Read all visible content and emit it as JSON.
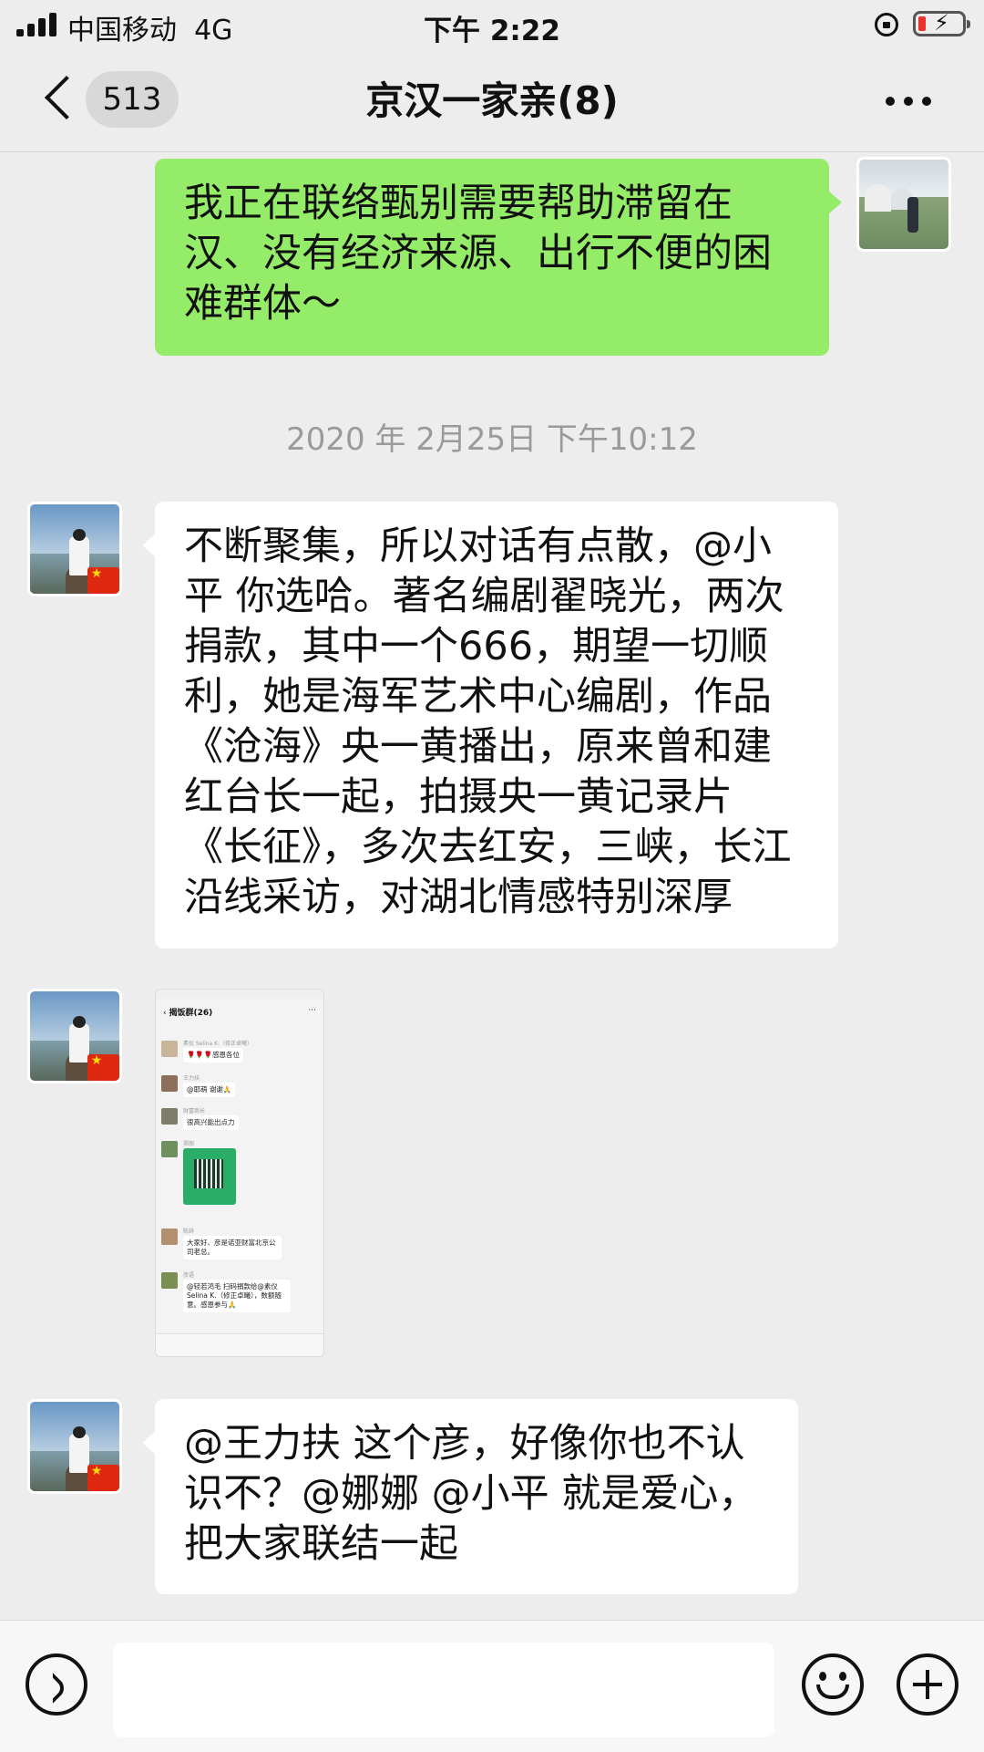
{
  "status_bar": {
    "carrier": "中国移动",
    "network": "4G",
    "time": "下午 2:22",
    "battery_color": "#e8332e"
  },
  "nav": {
    "unread_count": "513",
    "title": "京汉一家亲(8)"
  },
  "messages": [
    {
      "side": "right",
      "type": "text",
      "text": "我正在联络甄别需要帮助滞留在汉、没有经济来源、出行不便的困难群体～",
      "bubble_color": "#95ec69"
    },
    {
      "type": "timestamp",
      "text": "2020 年 2月25日 下午10:12"
    },
    {
      "side": "left",
      "type": "text",
      "text": "不断聚集，所以对话有点散，@小平 你选哈。著名编剧翟晓光，两次捐款，其中一个666，期望一切顺利，她是海军艺术中心编剧，作品《沧海》央一黄播出，原来曾和建红台长一起，拍摄央一黄记录片《长征》，多次去红安，三峡，长江沿线采访，对湖北情感特别深厚"
    },
    {
      "side": "left",
      "type": "image",
      "image": {
        "title": "揭饭群(26)",
        "rows": [
          {
            "name": "素仪 Selina K.（修正卓曦）",
            "text": "🌹🌹🌹感恩各位"
          },
          {
            "name": "王力扶",
            "text": "@耶萌  谢谢🙏"
          },
          {
            "name": "财富商长",
            "text": "很高兴能出点力"
          },
          {
            "name": "郑丽",
            "text": ""
          },
          {
            "name": "陈鋅",
            "text": "大家好、彦是诺亚财富北京公司老总。"
          },
          {
            "name": "彦语",
            "text": "@轻若鸿毛  扫码捐款给@素仪Selina K.（修正卓曦），数额随意。感恩参与🙏"
          }
        ]
      }
    },
    {
      "side": "left",
      "type": "text",
      "text": "@王力扶 这个彦，好像你也不认识不？@娜娜 @小平 就是爱心，把大家联结一起"
    }
  ],
  "input": {
    "value": "",
    "placeholder": ""
  },
  "icons": {
    "back": "chevron-left-icon",
    "more": "more-dots-icon",
    "voice": "voice-icon",
    "emoji": "emoji-icon",
    "add": "plus-icon"
  }
}
